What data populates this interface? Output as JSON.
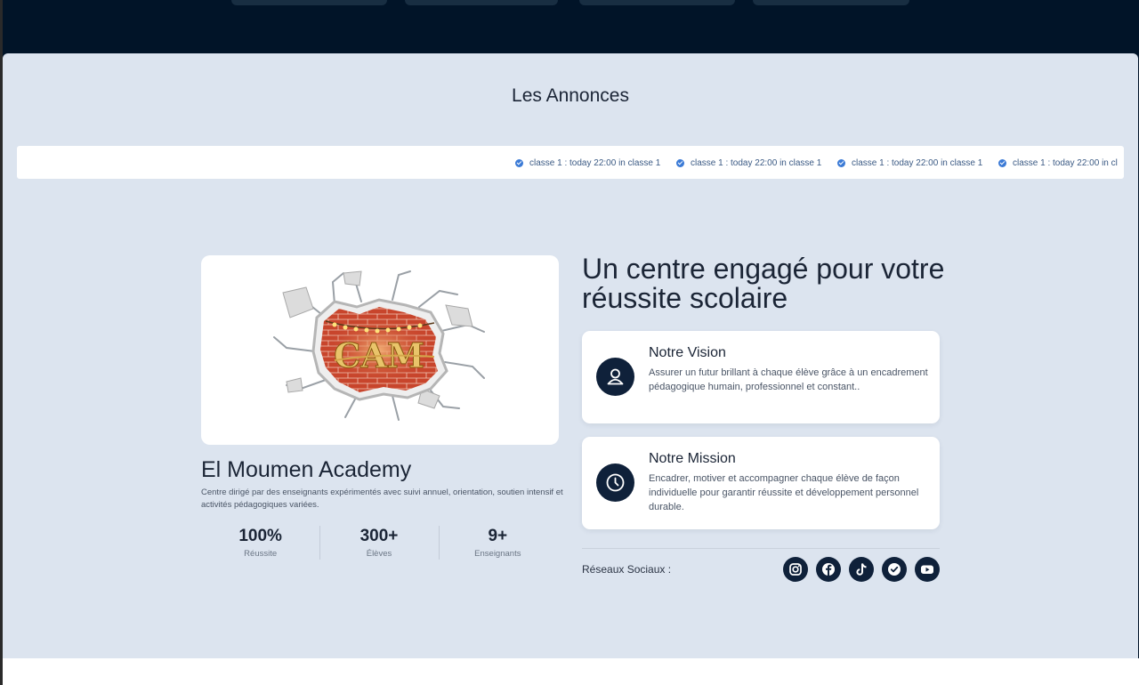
{
  "announcements": {
    "title": "Les Annonces",
    "items": [
      "classe 1 : today 22:00 in classe 1",
      "classe 1 : today 22:00 in classe 1",
      "classe 1 : today 22:00 in classe 1",
      "classe 1 : today 22:00 in cl"
    ]
  },
  "academy": {
    "logo_text": "CAM",
    "name": "El Moumen Academy",
    "description": "Centre dirigé par des enseignants expérimentés avec suivi annuel, orientation, soutien intensif et activités pédagogiques variées.",
    "stats": [
      {
        "value": "100%",
        "label": "Réussite"
      },
      {
        "value": "300+",
        "label": "Élèves"
      },
      {
        "value": "9+",
        "label": "Enseignants"
      }
    ]
  },
  "about": {
    "headline": "Un centre engagé pour votre réussite scolaire",
    "vision": {
      "title": "Notre Vision",
      "text": "Assurer un futur brillant à chaque élève grâce à un encadrement pédagogique humain, professionnel et constant.."
    },
    "mission": {
      "title": "Notre Mission",
      "text": "Encadrer, motiver et accompagner chaque élève de façon individuelle pour garantir réussite et développement personnel durable."
    }
  },
  "social": {
    "label": "Réseaux Sociaux :",
    "icons": [
      "instagram-icon",
      "facebook-icon",
      "tiktok-icon",
      "verified-icon",
      "youtube-icon"
    ]
  },
  "colors": {
    "page_bg": "#dce4ef",
    "dark_navy": "#011428",
    "icon_bg": "#0f213a",
    "check_blue": "#3c7bd6",
    "brick_red": "#c8452c"
  }
}
